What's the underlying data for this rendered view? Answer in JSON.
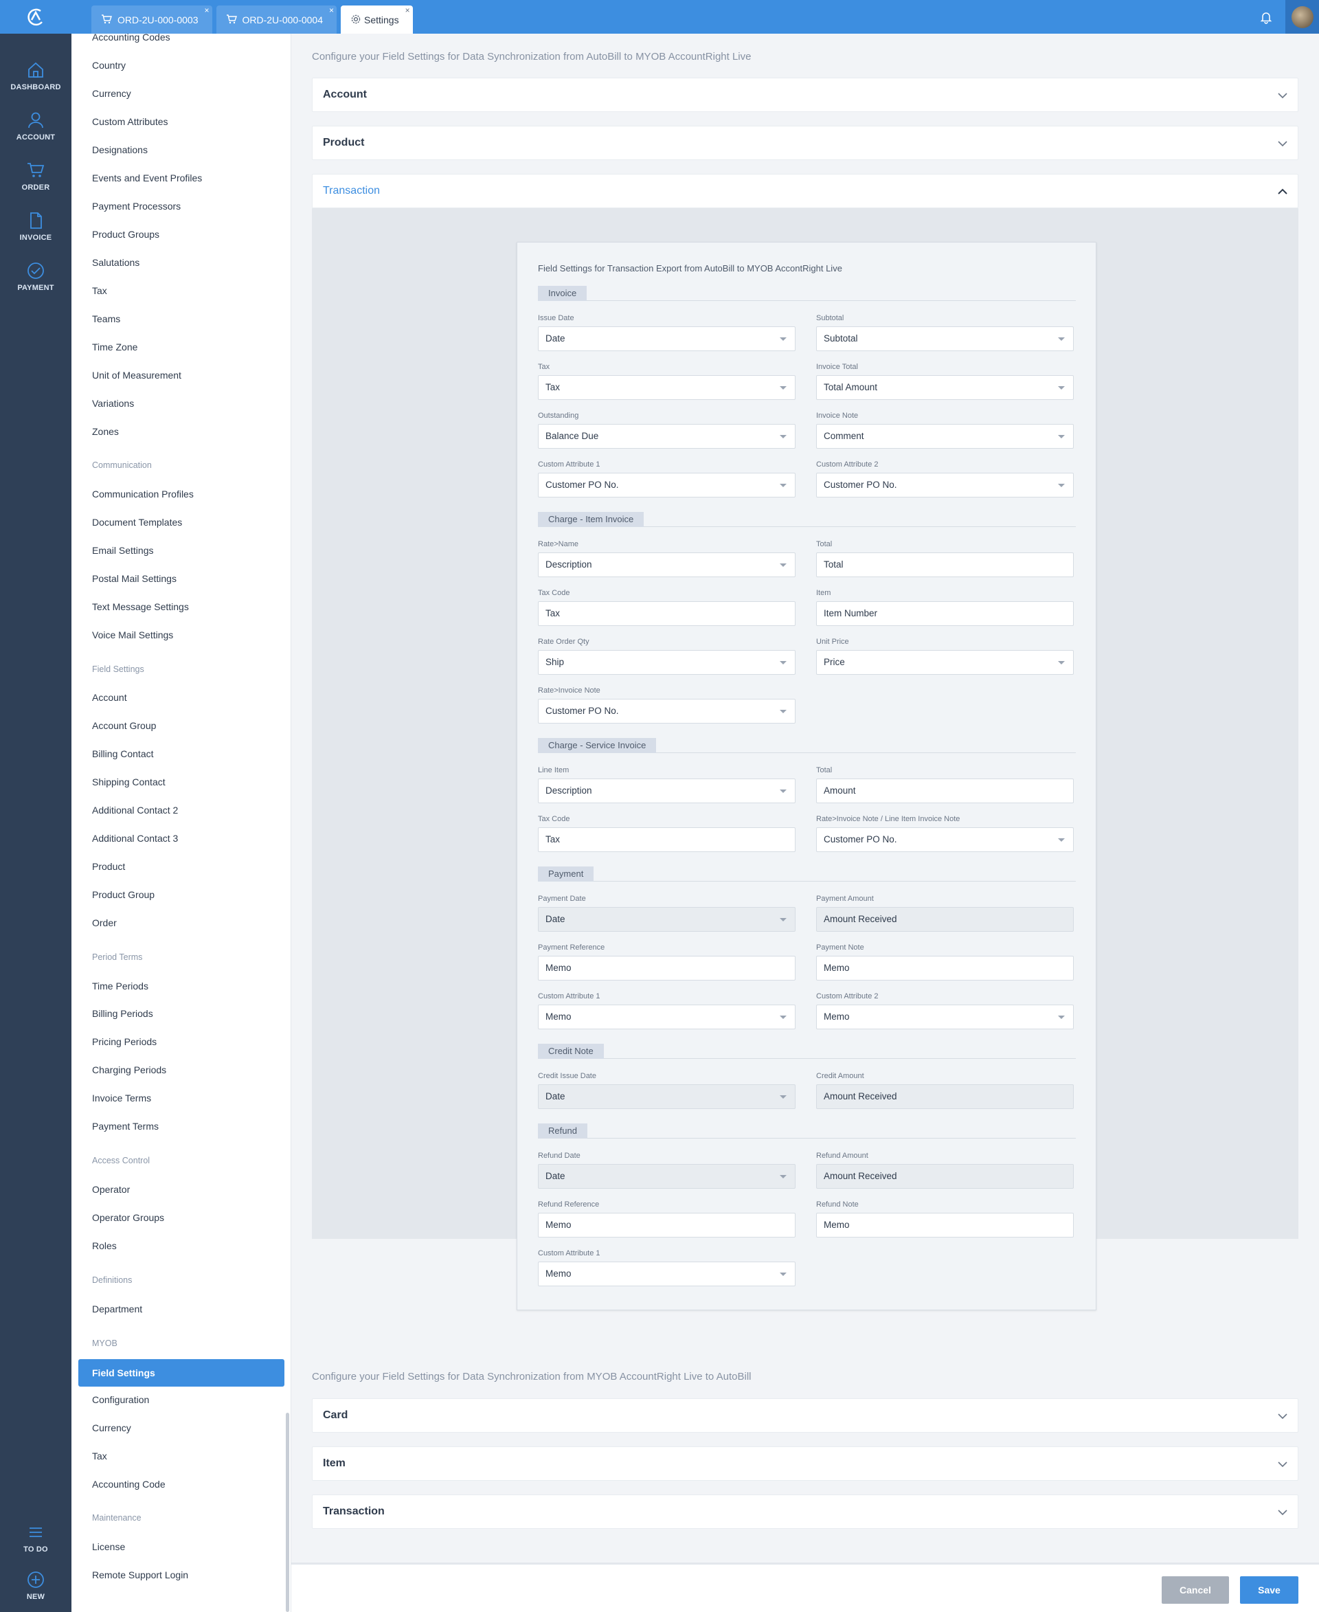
{
  "tabs": [
    {
      "label": "ORD-2U-000-0003"
    },
    {
      "label": "ORD-2U-000-0004"
    },
    {
      "label": "Settings"
    }
  ],
  "tab_close": "×",
  "nav": {
    "dashboard": "DASHBOARD",
    "account": "ACCOUNT",
    "order": "ORDER",
    "invoice": "INVOICE",
    "payment": "PAYMENT",
    "todo": "TO DO",
    "new": "NEW"
  },
  "sidebar": {
    "items_top": [
      "Accounting Codes",
      "Country",
      "Currency",
      "Custom Attributes",
      "Designations",
      "Events and Event Profiles",
      "Payment Processors",
      "Product Groups",
      "Salutations",
      "Tax",
      "Teams",
      "Time Zone",
      "Unit of Measurement",
      "Variations",
      "Zones"
    ],
    "communication_head": "Communication",
    "communication": [
      "Communication Profiles",
      "Document Templates",
      "Email Settings",
      "Postal Mail Settings",
      "Text Message Settings",
      "Voice Mail Settings"
    ],
    "field_settings_head": "Field Settings",
    "field_settings": [
      "Account",
      "Account Group",
      "Billing Contact",
      "Shipping Contact",
      "Additional Contact 2",
      "Additional Contact 3",
      "Product",
      "Product Group",
      "Order"
    ],
    "period_terms_head": "Period Terms",
    "period_terms": [
      "Time Periods",
      "Billing Periods",
      "Pricing Periods",
      "Charging Periods",
      "Invoice Terms",
      "Payment Terms"
    ],
    "access_control_head": "Access Control",
    "access_control": [
      "Operator",
      "Operator Groups",
      "Roles"
    ],
    "definitions_head": "Definitions",
    "definitions": [
      "Department"
    ],
    "myob_head": "MYOB",
    "myob_active": "Field Settings",
    "myob": [
      "Configuration",
      "Currency",
      "Tax",
      "Accounting Code"
    ],
    "maintenance_head": "Maintenance",
    "maintenance": [
      "License",
      "Remote Support Login"
    ]
  },
  "main": {
    "intro_export": "Configure your Field Settings for Data Synchronization from AutoBill to MYOB AccountRight Live",
    "intro_import": "Configure your Field Settings for Data Synchronization from MYOB AccountRight Live to AutoBill",
    "export_sections": [
      "Account",
      "Product",
      "Transaction"
    ],
    "import_sections": [
      "Card",
      "Item",
      "Transaction"
    ]
  },
  "card": {
    "title": "Field Settings for Transaction Export from AutoBill to MYOB AccontRight Live",
    "invoice": {
      "head": "Invoice",
      "issue_date_label": "Issue Date",
      "issue_date": "Date",
      "subtotal_label": "Subtotal",
      "subtotal": "Subtotal",
      "tax_label": "Tax",
      "tax": "Tax",
      "invoice_total_label": "Invoice Total",
      "invoice_total": "Total Amount",
      "outstanding_label": "Outstanding",
      "outstanding": "Balance Due",
      "invoice_note_label": "Invoice Note",
      "invoice_note": "Comment",
      "ca1_label": "Custom Attribute 1",
      "ca1": "Customer PO No.",
      "ca2_label": "Custom Attribute 2",
      "ca2": "Customer PO No."
    },
    "item_invoice": {
      "head": "Charge - Item Invoice",
      "rate_name_label": "Rate>Name",
      "rate_name": "Description",
      "total_label": "Total",
      "total": "Total",
      "tax_code_label": "Tax Code",
      "tax_code": "Tax",
      "item_label": "Item",
      "item": "Item Number",
      "rate_order_qty_label": "Rate Order Qty",
      "rate_order_qty": "Ship",
      "unit_price_label": "Unit Price",
      "unit_price": "Price",
      "rate_invoice_note_label": "Rate>Invoice Note",
      "rate_invoice_note": "Customer PO No."
    },
    "service_invoice": {
      "head": "Charge - Service Invoice",
      "line_item_label": "Line Item",
      "line_item": "Description",
      "total_label": "Total",
      "total": "Amount",
      "tax_code_label": "Tax Code",
      "tax_code": "Tax",
      "note_label": "Rate>Invoice Note / Line Item Invoice Note",
      "note": "Customer PO No."
    },
    "payment": {
      "head": "Payment",
      "date_label": "Payment Date",
      "date": "Date",
      "amount_label": "Payment Amount",
      "amount": "Amount Received",
      "reference_label": "Payment Reference",
      "reference": "Memo",
      "note_label": "Payment Note",
      "note": "Memo",
      "ca1_label": "Custom Attribute 1",
      "ca1": "Memo",
      "ca2_label": "Custom Attribute 2",
      "ca2": "Memo"
    },
    "credit_note": {
      "head": "Credit Note",
      "date_label": "Credit Issue Date",
      "date": "Date",
      "amount_label": "Credit Amount",
      "amount": "Amount Received"
    },
    "refund": {
      "head": "Refund",
      "date_label": "Refund Date",
      "date": "Date",
      "amount_label": "Refund Amount",
      "amount": "Amount Received",
      "reference_label": "Refund Reference",
      "reference": "Memo",
      "note_label": "Refund Note",
      "note": "Memo",
      "ca1_label": "Custom Attribute 1",
      "ca1": "Memo"
    }
  },
  "footer": {
    "cancel": "Cancel",
    "save": "Save"
  },
  "colors": {
    "accent": "#3d8ee0",
    "nav_bg": "#2f4057",
    "cancel": "#a8b0bb"
  }
}
